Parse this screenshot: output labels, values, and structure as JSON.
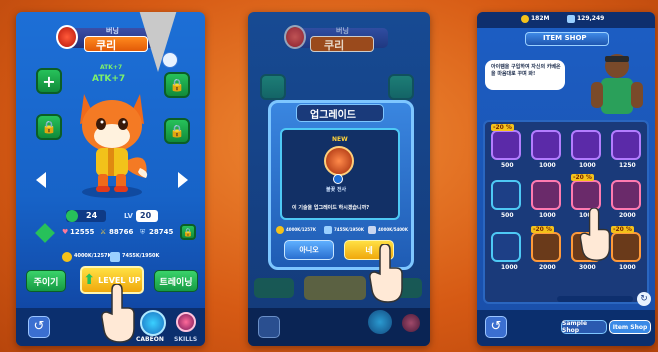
{
  "left": {
    "level_label": "버닝",
    "name": "쿠리",
    "atk_bonus": "ATK+7",
    "count": "24",
    "lv_label": "LV",
    "lv": "20",
    "stat_hp": "12555",
    "stat_atk": "88766",
    "stat_def": "28745",
    "res1": "4000K/1257K",
    "res2": "7455K/1950K",
    "btn_left": "주이기",
    "btn_center": "LEVEL UP",
    "btn_right": "트레이닝",
    "tab_cabeon": "CABEON",
    "tab_skills": "SKILLS"
  },
  "middle": {
    "level_label": "버닝",
    "name": "쿠리",
    "dialog_title": "업그레이드",
    "new_badge": "NEW",
    "item_label": "불꽃 전사",
    "question": "이 기술을 업그레이드 하시겠습니까?",
    "res1": "4000K/1257K",
    "res2": "7455K/1950K",
    "res3": "4000K/5400K",
    "cancel": "아니오",
    "confirm": "네"
  },
  "right": {
    "currency1": "182M",
    "currency2": "129,249",
    "title": "ITEM SHOP",
    "speech": "아이템을 구입하여 자신의 카베온을 마음대로 꾸며 봐!",
    "discount": "-20 %",
    "prices": [
      "500",
      "1000",
      "1000",
      "1250",
      "500",
      "1000",
      "1000",
      "2000",
      "1000",
      "2000",
      "3000",
      "1000"
    ],
    "tab_sample": "Sample Shop",
    "tab_item": "Item Shop"
  },
  "colors": {
    "accent_green": "#27c15a",
    "accent_yellow": "#f4c21b",
    "accent_blue": "#1d6fd6"
  }
}
